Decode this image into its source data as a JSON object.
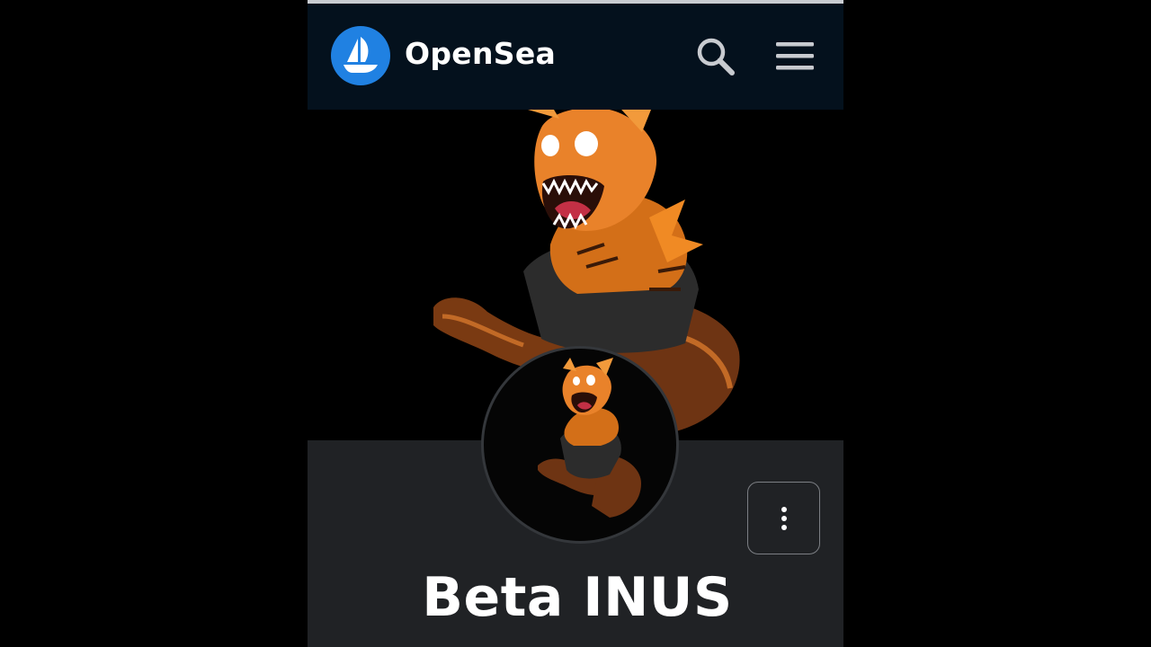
{
  "app": {
    "brand_name": "OpenSea",
    "brand_color": "#2081e2",
    "nav_background": "#04111d"
  },
  "header": {
    "icons": [
      "opensea-logo-icon",
      "search-icon",
      "hamburger-menu-icon"
    ]
  },
  "collection": {
    "name": "Beta INUS",
    "banner_image": "tiger-warrior-artwork",
    "avatar_image": "tiger-warrior-artwork",
    "more_options_icon": "vertical-ellipsis-icon"
  }
}
